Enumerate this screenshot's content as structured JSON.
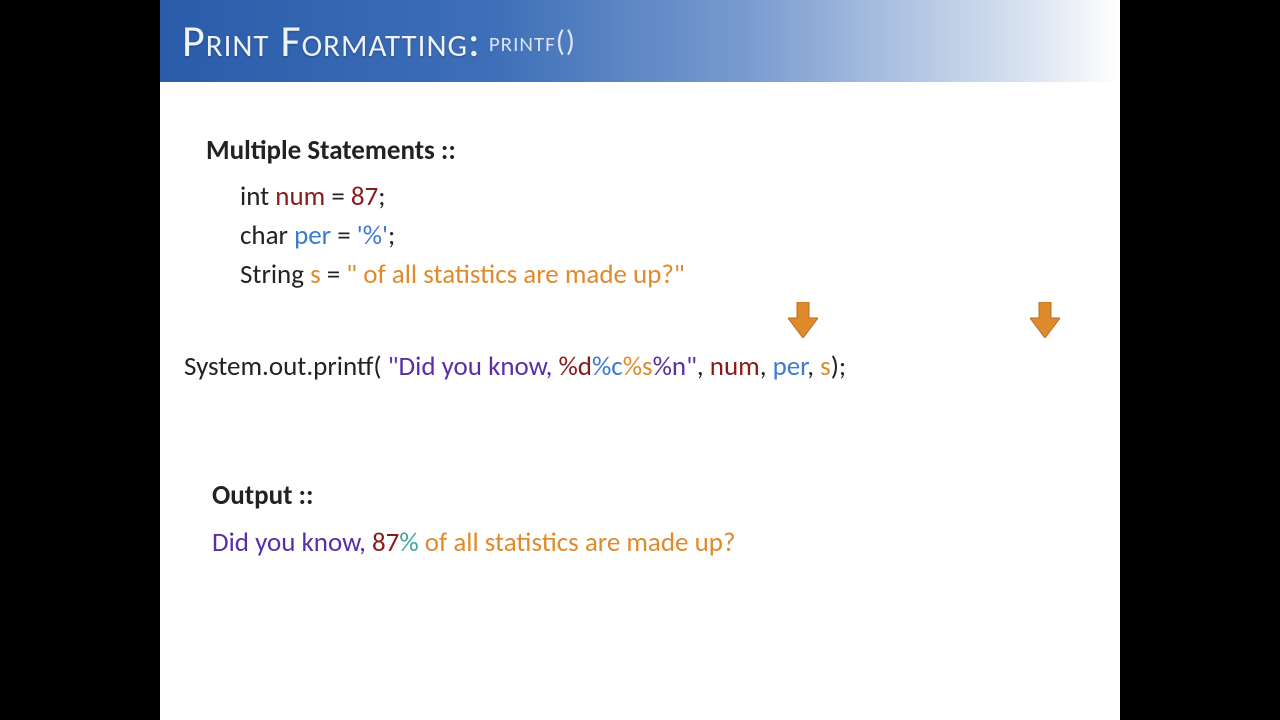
{
  "title": {
    "main": "Print Formatting:",
    "sub": "printf()"
  },
  "heading": "Multiple Statements ::",
  "decl": {
    "l1": {
      "kw": "int ",
      "name": "num",
      "rest": " = ",
      "val": "87",
      "semi": ";"
    },
    "l2": {
      "kw": "char ",
      "name": "per",
      "rest": " = ",
      "val": "'%'",
      "semi": ";"
    },
    "l3": {
      "kw": "String ",
      "name": "s",
      "rest": " = ",
      "val": "\" of all statistics are made up?\""
    }
  },
  "printf": {
    "pre": "System.out.printf( ",
    "q1": "\"",
    "did": "Did you know, ",
    "d": "%d",
    "c": "%c",
    "s": "%s",
    "n": "%n",
    "q2": "\"",
    "c1": ", ",
    "a1": "num",
    "c2": ", ",
    "a2": "per",
    "c3": ", ",
    "a3": "s",
    "end": ");"
  },
  "output_heading": "Output ::",
  "output": {
    "did": "Did you know,  ",
    "num": "87",
    "pct": "%",
    "rest": " of all statistics are made up?"
  }
}
